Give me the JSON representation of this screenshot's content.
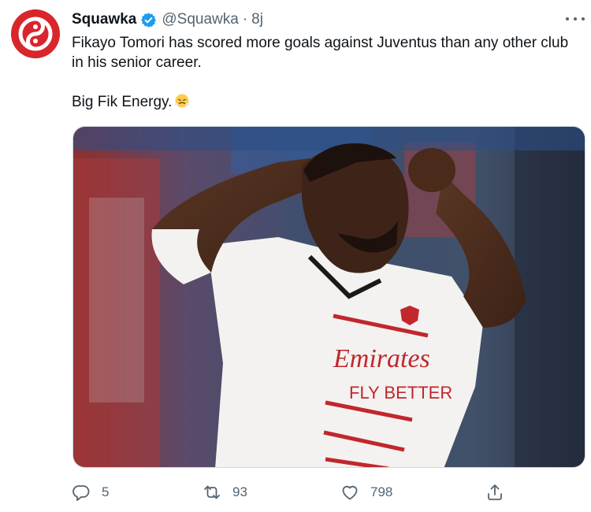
{
  "tweet": {
    "author_name": "Squawka",
    "handle": "@Squawka",
    "separator": "·",
    "time": "8j",
    "text_line1": "Fikayo Tomori has scored more goals against Juventus than any other club in his senior career.",
    "text_line2": "Big Fik Energy.",
    "emoji": "face-with-steam-from-nose",
    "media_text": {
      "sponsor_top": "Emirates",
      "sponsor_bottom": "FLY BETTER"
    }
  },
  "actions": {
    "reply_count": "5",
    "retweet_count": "93",
    "like_count": "798"
  },
  "colors": {
    "brand": "#d8262c",
    "verified": "#1d9bf0",
    "secondary_text": "#536471",
    "primary_text": "#0f1419"
  },
  "icons": [
    "squawka-logo",
    "verified-badge-icon",
    "more-icon",
    "reply-icon",
    "retweet-icon",
    "like-icon",
    "share-icon"
  ]
}
